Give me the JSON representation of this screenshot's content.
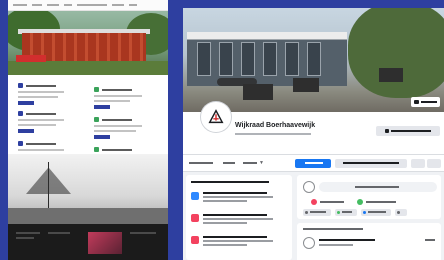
{
  "facebook": {
    "page_title": "Wijkraad Boerhaavewijk"
  },
  "colors": {
    "background": "#2e3fa0",
    "facebook_blue": "#1877f2",
    "site_accent": "#2e3fa0",
    "site_alert": "#d22e2e",
    "facebook_row_icons": [
      "#2d88ff",
      "#f3425f",
      "#f3425f"
    ]
  },
  "icons": {
    "site_card_icons": [
      "square-icon",
      "square-icon",
      "square-icon",
      "square-icon",
      "square-icon",
      "square-icon"
    ],
    "facebook_avatar": "logo-icon",
    "cover_edit": "camera-icon",
    "edit_page": "pencil-icon",
    "composer_actions": [
      "video-icon",
      "photo-icon",
      "smile-icon"
    ]
  }
}
